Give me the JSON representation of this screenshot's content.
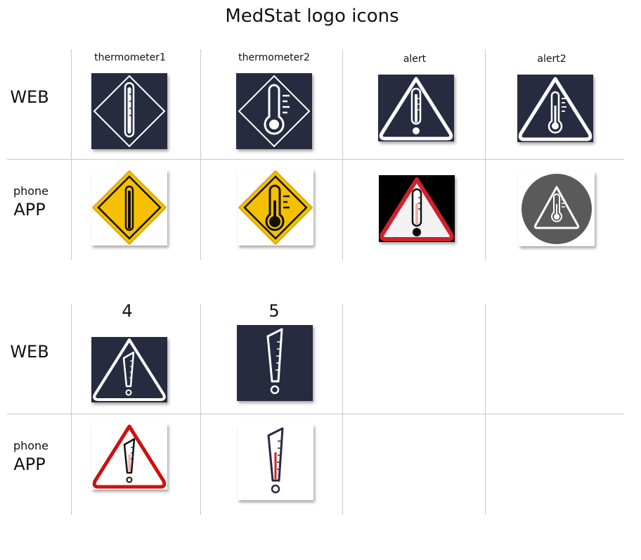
{
  "title": "MedStat logo icons",
  "rows": {
    "web": "WEB",
    "phone": "phone",
    "app": "APP"
  },
  "columns": [
    "thermometer1",
    "thermometer2",
    "alert",
    "alert2"
  ],
  "numbers": [
    "4",
    "5"
  ],
  "colors": {
    "navy": "#262b40",
    "yellow": "#f5c000",
    "red": "#d0202a",
    "gray": "#5a5a5a",
    "pink": "#f4b0b0"
  }
}
